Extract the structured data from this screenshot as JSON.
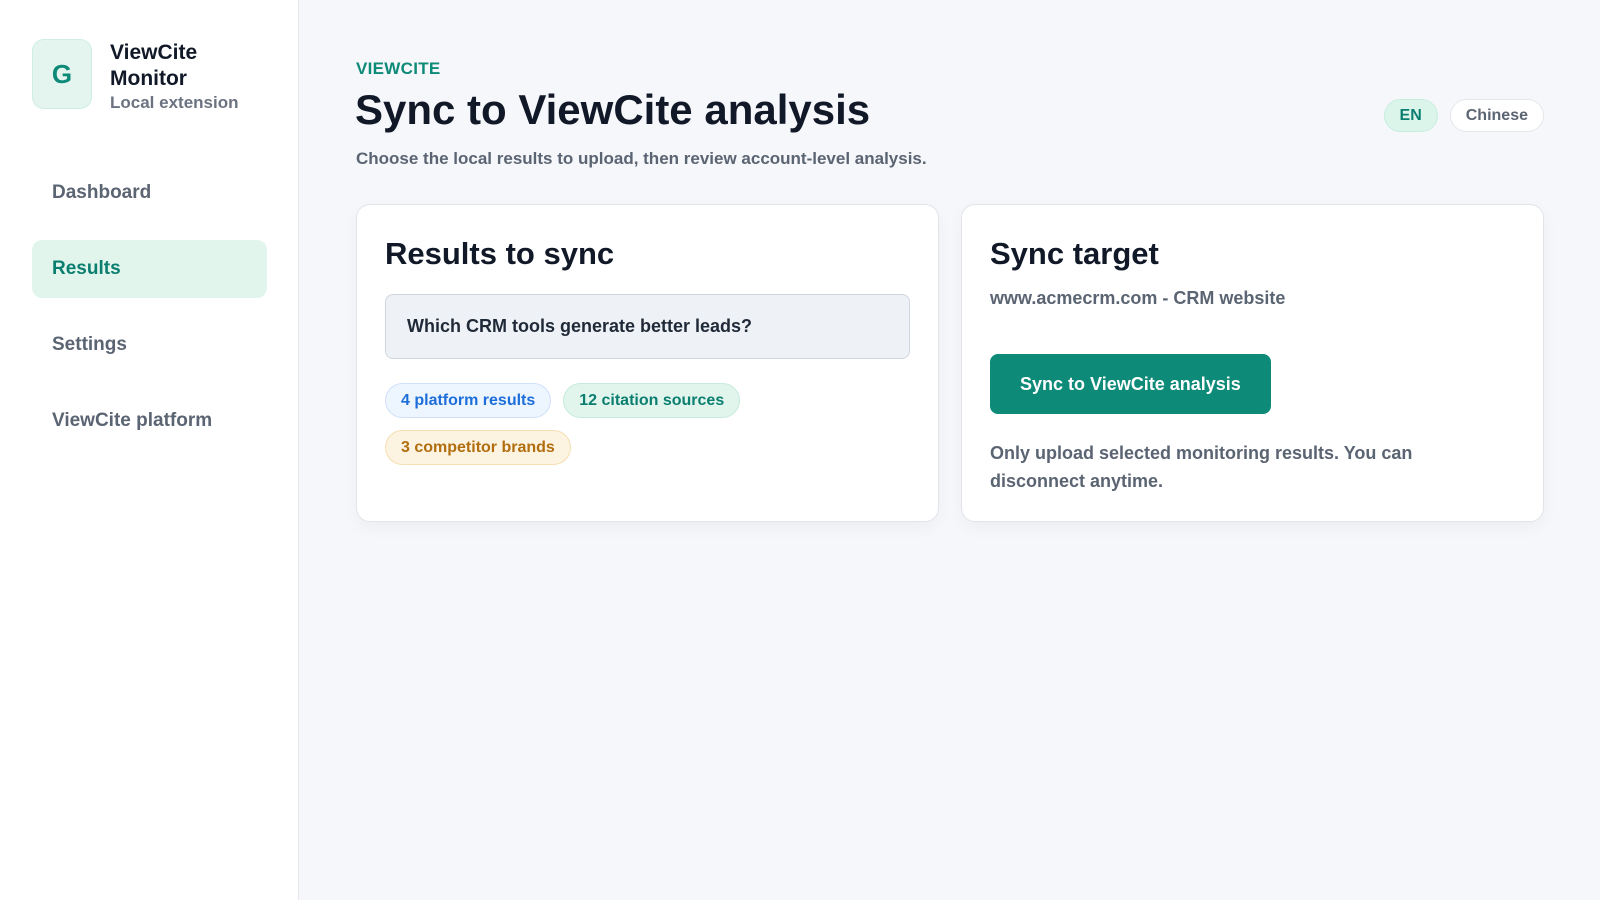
{
  "brand": {
    "logo_letter": "G",
    "name": "ViewCite Monitor",
    "subtitle": "Local extension"
  },
  "sidebar": {
    "items": [
      {
        "label": "Dashboard",
        "active": false
      },
      {
        "label": "Results",
        "active": true
      },
      {
        "label": "Settings",
        "active": false
      },
      {
        "label": "ViewCite platform",
        "active": false
      }
    ]
  },
  "header": {
    "eyebrow": "VIEWCITE",
    "title": "Sync to ViewCite analysis",
    "subtitle": "Choose the local results to upload, then review account-level analysis."
  },
  "language": {
    "options": [
      "EN",
      "Chinese"
    ],
    "selected": "EN"
  },
  "results_card": {
    "title": "Results to sync",
    "query": "Which CRM tools generate better leads?",
    "tags": [
      {
        "label": "4 platform results",
        "color": "#1d6ed8"
      },
      {
        "label": "12 citation sources",
        "color": "#0b7e70"
      },
      {
        "label": "3 competitor brands",
        "color": "#b06e0f"
      }
    ]
  },
  "target_card": {
    "title": "Sync target",
    "site": "www.acmecrm.com - CRM website",
    "button_label": "Sync to ViewCite analysis",
    "note": "Only upload selected monitoring results. You can disconnect anytime."
  },
  "colors": {
    "accent": "#0d8a78",
    "background": "#f5f7fa"
  }
}
